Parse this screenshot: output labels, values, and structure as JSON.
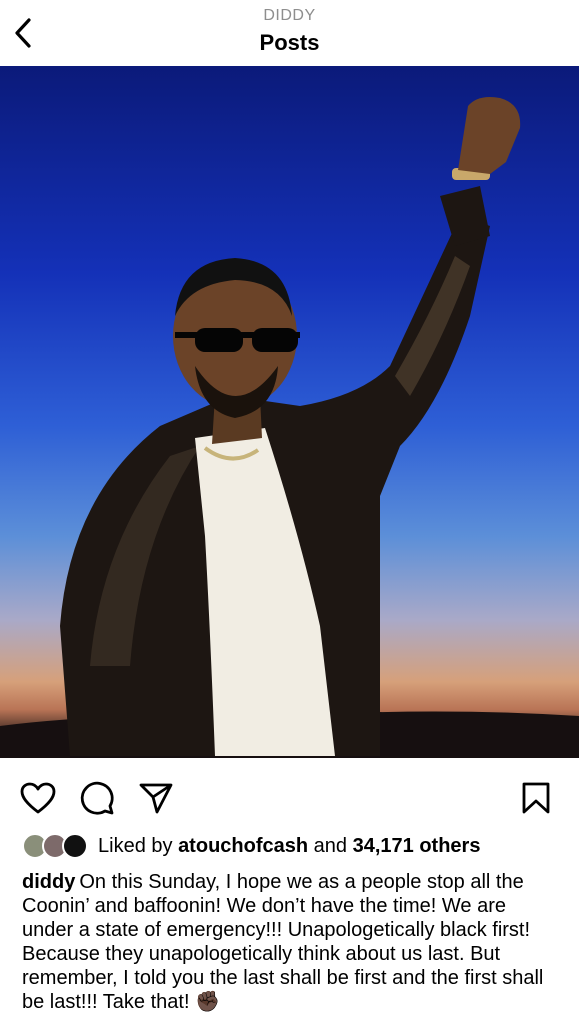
{
  "header": {
    "subtitle": "DIDDY",
    "title": "Posts",
    "back_icon": "chevron-left-icon"
  },
  "post": {
    "image_alt": "photo",
    "actions": {
      "like_icon": "heart-icon",
      "comment_icon": "comment-icon",
      "share_icon": "send-icon",
      "save_icon": "bookmark-icon"
    },
    "likes": {
      "prefix": "Liked by",
      "first_user": "atouchofcash",
      "conjunction": "and",
      "others": "34,171 others"
    },
    "caption": {
      "username": "diddy",
      "text": "On this Sunday, I hope we as a people stop all the Coonin’ and baffoonin! We don’t have the time! We are under a state of emergency!!! Unapologetically black first! Because they unapologetically think about us last. But remember, I told you the last shall be first and the first shall be last!!! Take that! ✊🏿"
    }
  },
  "colors": {
    "background": "#ffffff",
    "text": "#000000",
    "muted": "#8e8e8e"
  }
}
